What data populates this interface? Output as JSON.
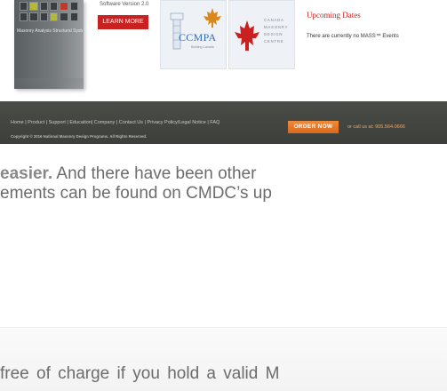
{
  "product": {
    "box_caption": "Masonry Analysis Structural Systems",
    "software_version": "Software Version 2.0",
    "learn_more_label": "LEARN MORE"
  },
  "partners": {
    "ccmpa_label": "CCMPA",
    "ccmpa_sub": "Building Canada",
    "cmdc_lines": [
      "CANADA",
      "MASONRY",
      "DESIGN",
      "CENTRE"
    ]
  },
  "events": {
    "title": "Upcoming Dates",
    "text": "There are currently no MASS™ Events"
  },
  "footer": {
    "nav": "Home | Product | Support | Education| Company | Contact Us  | Privacy Policy/Legal Notice | FAQ",
    "copyright": "Copyright © 2016 National Masonry Design Programs. All Rights Reserved.",
    "order_now_label": "ORDER NOW",
    "call_us": "or call us at: 905.564.0666"
  },
  "article": {
    "line1_strong": "easier.",
    "line1_rest": " And there have been other",
    "line2": "ements can be found on CMDC’s up",
    "line3": "free of charge if you hold a valid M"
  },
  "colors": {
    "accent_red": "#c8211f",
    "footer_bg": "#44473f",
    "order_orange": "#e67a2c",
    "cmdc_purple": "#8c7a9c",
    "ccmpa_blue": "#2f6db2"
  }
}
